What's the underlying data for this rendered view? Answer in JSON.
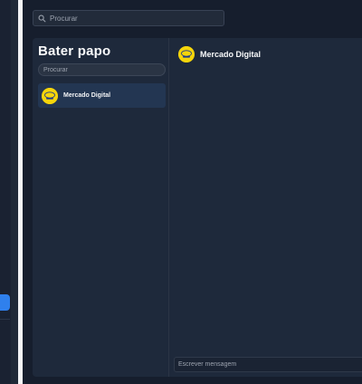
{
  "top_search": {
    "placeholder": "Procurar"
  },
  "chat_list": {
    "title": "Bater papo",
    "search_placeholder": "Procurar",
    "conversations": [
      {
        "name": "Mercado Digital",
        "avatar": "mercado-digital-logo"
      }
    ]
  },
  "chat_view": {
    "contact_name": "Mercado Digital",
    "message_placeholder": "Escrever mensagem"
  },
  "colors": {
    "accent": "#2f80ed",
    "selected_item": "#233652",
    "avatar_bg": "#f5d50b"
  }
}
